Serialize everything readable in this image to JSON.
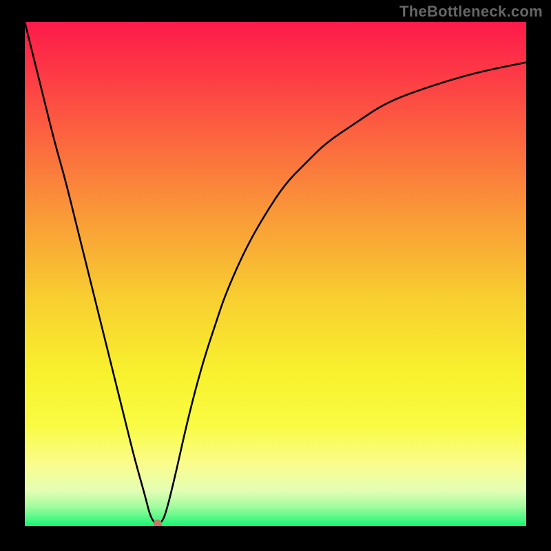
{
  "watermark": "TheBottleneck.com",
  "colors": {
    "background": "#000000",
    "watermark": "#666666",
    "curve": "#000000",
    "marker_fill": "#c67866",
    "gradient_stops": [
      {
        "offset": 0.0,
        "color": "#fd1a4a"
      },
      {
        "offset": 0.1,
        "color": "#fd3946"
      },
      {
        "offset": 0.25,
        "color": "#fb6c3e"
      },
      {
        "offset": 0.4,
        "color": "#f99f37"
      },
      {
        "offset": 0.55,
        "color": "#f8cf30"
      },
      {
        "offset": 0.7,
        "color": "#f8f22e"
      },
      {
        "offset": 0.8,
        "color": "#f9fb43"
      },
      {
        "offset": 0.88,
        "color": "#fafd8f"
      },
      {
        "offset": 0.93,
        "color": "#e3feb4"
      },
      {
        "offset": 0.96,
        "color": "#a4fca0"
      },
      {
        "offset": 0.985,
        "color": "#4ef884"
      },
      {
        "offset": 1.0,
        "color": "#15f574"
      }
    ]
  },
  "chart_data": {
    "type": "line",
    "title": "",
    "xlabel": "",
    "ylabel": "",
    "xlim": [
      0,
      100
    ],
    "ylim": [
      0,
      100
    ],
    "x": [
      0,
      2,
      4,
      6,
      8,
      10,
      12,
      14,
      16,
      18,
      20,
      22,
      24,
      25,
      26,
      27,
      28,
      30,
      32,
      34,
      36,
      38,
      40,
      44,
      48,
      52,
      56,
      60,
      66,
      72,
      80,
      90,
      100
    ],
    "values": [
      100,
      92,
      84,
      76,
      69,
      61,
      53,
      45,
      37,
      29,
      21,
      13,
      6,
      2,
      0.5,
      0.5,
      2,
      10,
      19,
      27,
      34,
      40,
      46,
      55,
      62,
      68,
      72,
      76,
      80,
      84,
      87,
      90,
      92
    ],
    "marker": {
      "x": 26.5,
      "y": 0.5
    },
    "annotations": []
  }
}
